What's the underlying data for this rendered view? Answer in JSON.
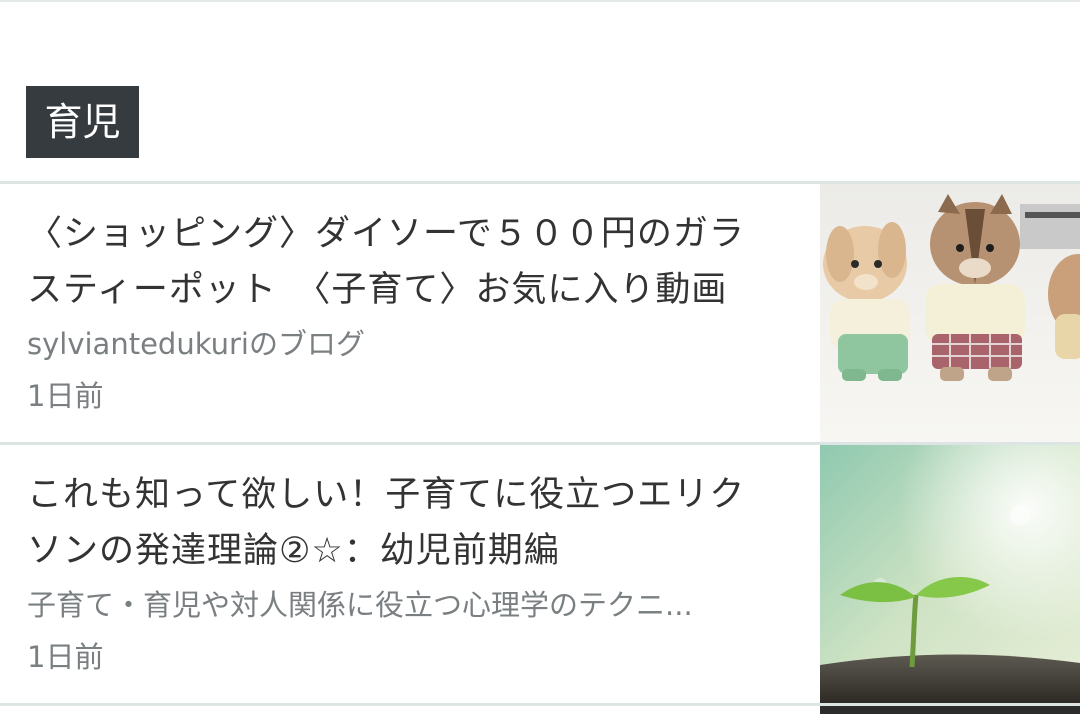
{
  "category": {
    "label": "育児"
  },
  "articles": [
    {
      "title": "〈ショッピング〉ダイソーで５００円のガラスティーポット　〈子育て〉お気に入り動画",
      "title_lines": [
        "〈ショッピング〉ダイソーで５００円のガラ",
        "スティーポット　〈子育て〉お気に入り動画"
      ],
      "source": "sylviantedukuriのブログ",
      "time": "1日前",
      "thumbnail_icon": "figurine-toys-photo"
    },
    {
      "title": "これも知って欲しい！子育てに役立つエリクソンの発達理論②☆：幼児前期編",
      "title_lines": [
        "これも知って欲しい！子育てに役立つエリク",
        "ソンの発達理論②☆：幼児前期編"
      ],
      "source": "子育て・育児や対人関係に役立つ心理学のテクニ...",
      "time": "1日前",
      "thumbnail_icon": "sprout-photo"
    }
  ],
  "colors": {
    "tag_background": "#363b3f",
    "title_text": "#333333",
    "meta_text": "#7a7f82",
    "divider": "#dde5e4"
  }
}
